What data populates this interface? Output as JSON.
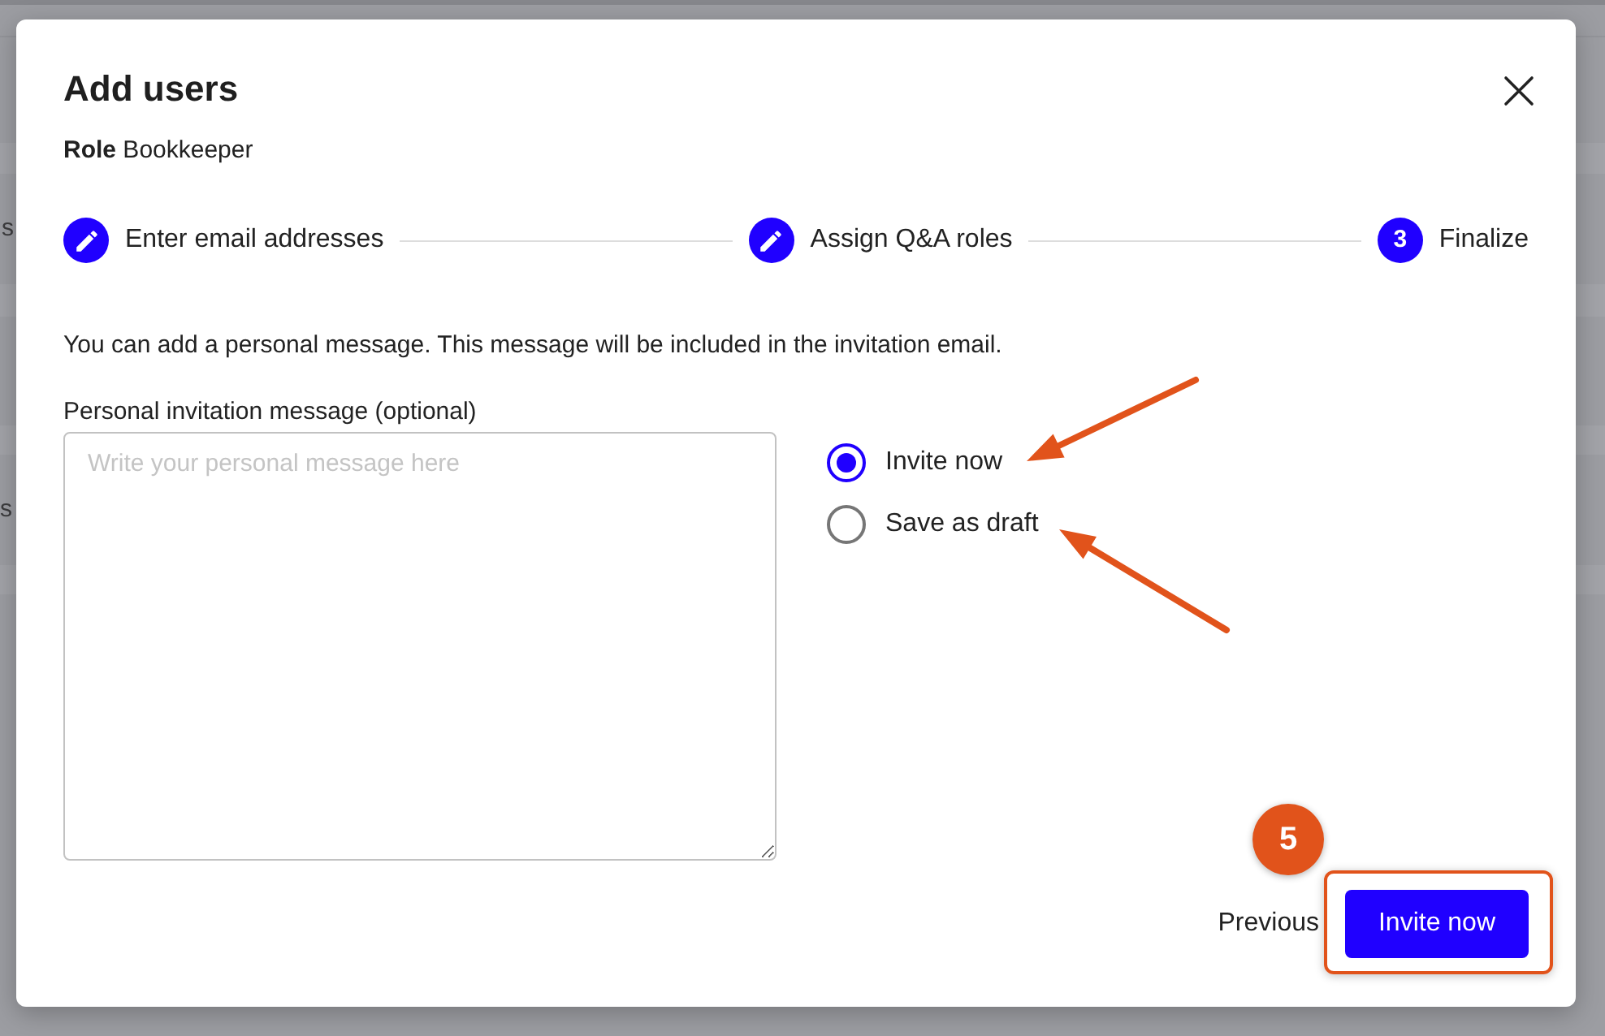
{
  "background_page": {
    "fragments": [
      "s",
      "s"
    ]
  },
  "dialog": {
    "title": "Add users",
    "role": "**Role** Bookkeeper",
    "steps": [
      {
        "label": "Enter email addresses",
        "kind": "done"
      },
      {
        "label": "Assign Q&A roles",
        "kind": "done"
      },
      {
        "label": "Finalize",
        "kind": "current",
        "number": "3"
      }
    ],
    "intro": "You can add a personal message. This message will be included in the invitation email.",
    "message_field": {
      "label": "Personal invitation message (optional)",
      "placeholder": "Write your personal message here"
    },
    "options": [
      {
        "label": "Invite now",
        "selected": true
      },
      {
        "label": "Save as draft",
        "selected": false
      }
    ],
    "buttons": {
      "previous": "Previous",
      "primary": "Invite now"
    }
  },
  "annotations": {
    "step_badge": "5"
  }
}
